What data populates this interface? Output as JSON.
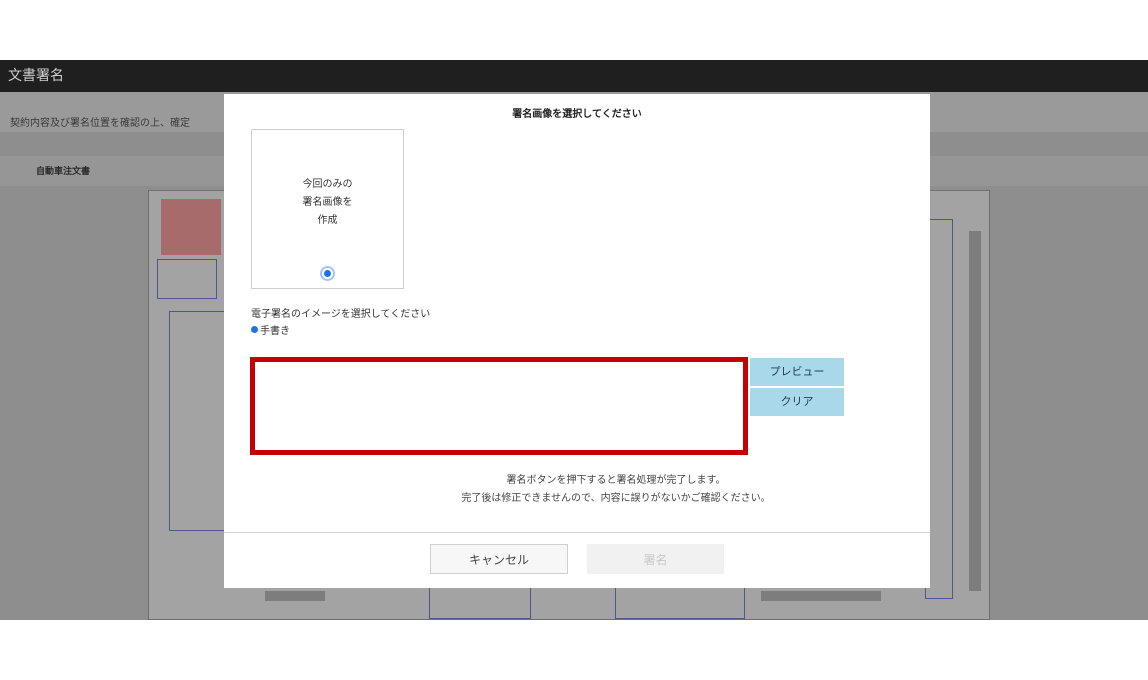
{
  "app": {
    "title": "文書署名"
  },
  "instruction": "契約内容及び署名位置を確認の上、確定",
  "tabs": [
    {
      "label": "自動車注文書"
    }
  ],
  "modal": {
    "title": "署名画像を選択してください",
    "option": {
      "label": "今回のみの\n署名画像を\n作成",
      "selected": true
    },
    "select_label": "電子署名のイメージを選択してください",
    "handwrite_label": "手書き",
    "preview_label": "プレビュー",
    "clear_label": "クリア",
    "note_line1": "署名ボタンを押下すると署名処理が完了します。",
    "note_line2": "完了後は修正できませんので、内容に誤りがないかご確認ください。",
    "cancel_label": "キャンセル",
    "sign_label": "署名"
  },
  "colors": {
    "highlight": "#c40000",
    "accent_button": "#a8d8ea",
    "radio": "#1a73e8"
  }
}
